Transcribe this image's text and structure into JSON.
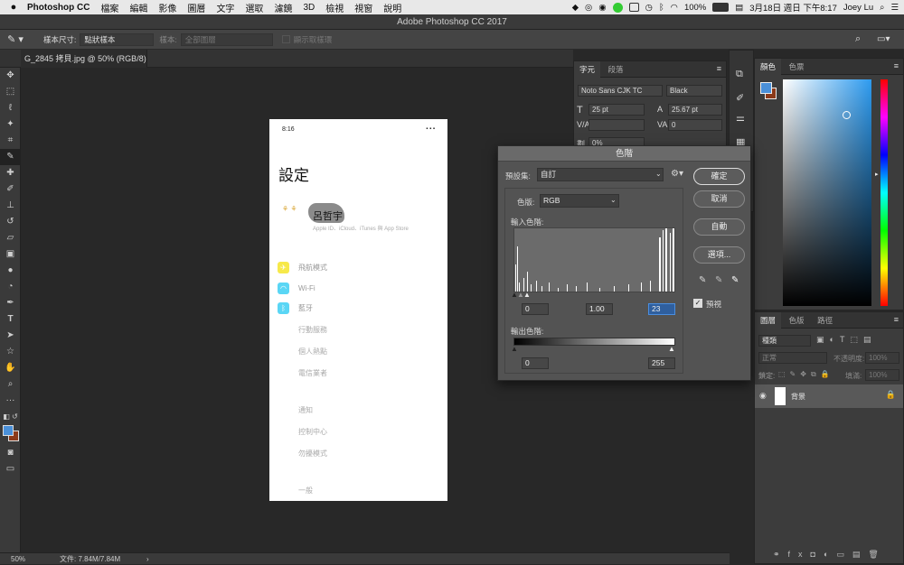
{
  "menubar": {
    "app_name": "Photoshop CC",
    "items": [
      "檔案",
      "編輯",
      "影像",
      "圖層",
      "文字",
      "選取",
      "濾鏡",
      "3D",
      "檢視",
      "視窗",
      "說明"
    ],
    "battery": "100%",
    "datetime": "3月18日 週日 下午8:17",
    "user": "Joey Lu"
  },
  "window": {
    "title": "Adobe Photoshop CC 2017"
  },
  "options": {
    "sample_size_label": "樣本尺寸:",
    "sample_size_value": "點狀樣本",
    "sample_label": "樣本:",
    "sample_value": "全部圖層",
    "show_ring_label": "顯示取樣環"
  },
  "document": {
    "tab_title": "G_2845 拷貝.jpg @ 50% (RGB/8)",
    "zoom": "50%",
    "file_info": "文件: 7.84M/7.84M"
  },
  "phone": {
    "time": "8:16",
    "title": "設定",
    "profile_name": "呂哲宇",
    "profile_sub": "Apple ID、iCloud、iTunes 與 App Store",
    "rows": [
      {
        "label": "飛航模式",
        "icon": "airplane-icon",
        "color": "#f7e94a"
      },
      {
        "label": "Wi-Fi",
        "icon": "wifi-icon",
        "color": "#5ad6f5"
      },
      {
        "label": "藍牙",
        "icon": "bluetooth-icon",
        "color": "#5ad6f5"
      },
      {
        "label": "行動服務",
        "icon": "",
        "color": ""
      },
      {
        "label": "個人熱點",
        "icon": "",
        "color": ""
      },
      {
        "label": "電信業者",
        "icon": "",
        "color": ""
      }
    ],
    "rows2": [
      "通知",
      "控制中心",
      "勿擾模式"
    ],
    "rows3": [
      "一般"
    ]
  },
  "char_panel": {
    "tabs": [
      "字元",
      "段落"
    ],
    "font_family": "Noto Sans CJK TC",
    "font_style": "Black",
    "font_size": "25 pt",
    "leading": "25.67 pt",
    "kerning": "",
    "tracking": "0",
    "scale": "0%"
  },
  "color_panel": {
    "tabs": [
      "顏色",
      "色票"
    ],
    "fg": "#4a90d9",
    "bg": "#8b3a1a"
  },
  "layers_panel": {
    "tabs": [
      "圖層",
      "色版",
      "路徑"
    ],
    "filter": "種類",
    "blend": "正常",
    "opacity_label": "不透明度:",
    "opacity": "100%",
    "lock_label": "鎖定:",
    "fill_label": "填滿:",
    "fill": "100%",
    "layer_name": "背景"
  },
  "levels": {
    "title": "色階",
    "preset_label": "預設集:",
    "preset_value": "自訂",
    "channel_label": "色版:",
    "channel_value": "RGB",
    "input_label": "輸入色階:",
    "input_black": "0",
    "input_gamma": "1.00",
    "input_white": "23",
    "output_label": "輸出色階:",
    "output_black": "0",
    "output_white": "255",
    "ok": "確定",
    "cancel": "取消",
    "auto": "自動",
    "options": "選項...",
    "preview": "預視"
  }
}
